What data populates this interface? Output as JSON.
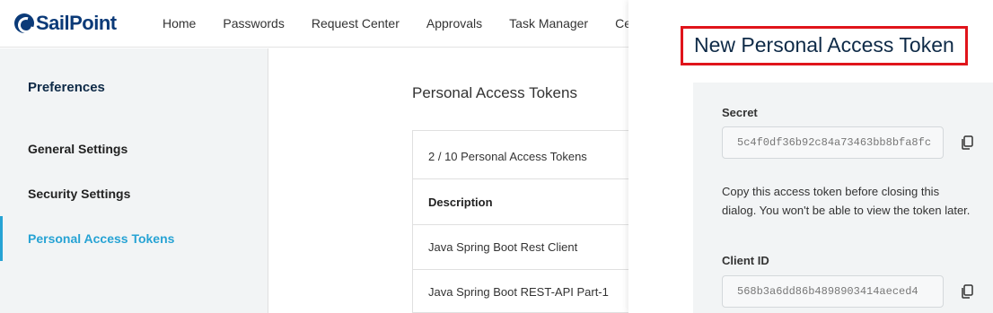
{
  "brand": {
    "name": "SailPoint"
  },
  "nav": {
    "items": [
      "Home",
      "Passwords",
      "Request Center",
      "Approvals",
      "Task Manager",
      "Certi"
    ]
  },
  "sidebar": {
    "title": "Preferences",
    "items": [
      {
        "label": "General Settings",
        "active": false
      },
      {
        "label": "Security Settings",
        "active": false
      },
      {
        "label": "Personal Access Tokens",
        "active": true
      }
    ]
  },
  "main": {
    "title": "Personal Access Tokens",
    "count_label": "2 / 10 Personal Access Tokens",
    "column_header": "Description",
    "rows": [
      "Java Spring Boot Rest Client",
      "Java Spring Boot REST-API Part-1"
    ]
  },
  "panel": {
    "title": "New Personal Access Token",
    "secret_label": "Secret",
    "secret_value": "5c4f0df36b92c84a73463bb8bfa8fc",
    "note": "Copy this access token before closing this dialog. You won't be able to view the token later.",
    "client_id_label": "Client ID",
    "client_id_value": "568b3a6dd86b4898903414aeced4"
  },
  "colors": {
    "brand": "#0b3a78",
    "accent": "#27a3d4",
    "highlight": "#e0141b"
  },
  "icons": {
    "copy": "copy-icon",
    "logo": "sailpoint-logo-icon"
  }
}
